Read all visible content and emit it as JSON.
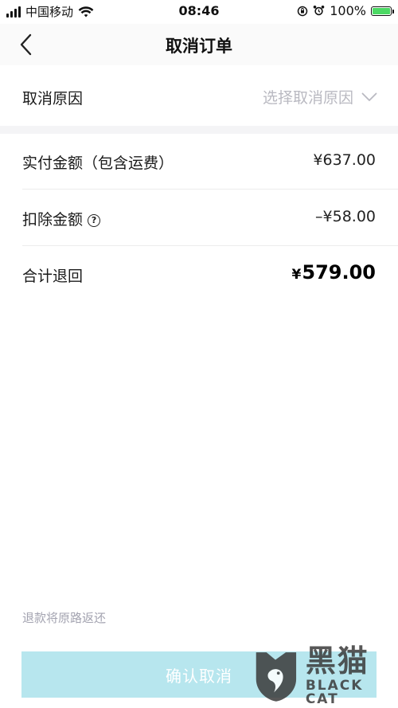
{
  "status_bar": {
    "carrier": "中国移动",
    "time": "08:46",
    "battery": "100%",
    "battery_level": 1.0
  },
  "nav": {
    "title": "取消订单"
  },
  "reason": {
    "label": "取消原因",
    "placeholder": "选择取消原因"
  },
  "amounts": {
    "paid_label": "实付金额（包含运费）",
    "paid_value": "¥637.00",
    "deduct_label": "扣除金额",
    "deduct_value": "–¥58.00",
    "total_label": "合计退回",
    "total_currency": "¥",
    "total_value": "579.00"
  },
  "footer": {
    "note": "退款将原路返还",
    "confirm_label": "确认取消"
  },
  "watermark": {
    "cn": "黑猫",
    "en": "BLACK CAT"
  },
  "icons": {
    "back": "chevron-left-icon",
    "dropdown": "chevron-down-icon",
    "help": "question-circle-icon",
    "wifi": "wifi-icon",
    "alarm": "alarm-icon",
    "rotation_lock": "rotation-lock-icon"
  },
  "colors": {
    "confirm_button_bg": "#b7e6ee",
    "placeholder_text": "#b9b9c1",
    "battery_fill": "#4cd964",
    "note_text": "#a3a3b0"
  }
}
